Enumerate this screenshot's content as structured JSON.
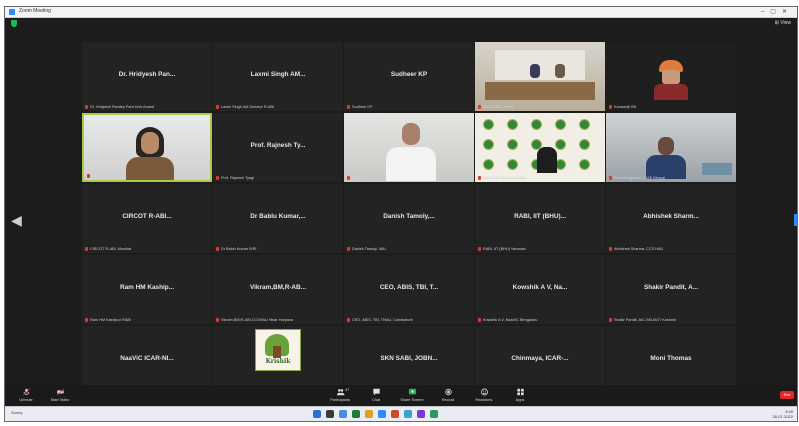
{
  "window": {
    "title": "Zoom Meeting"
  },
  "view_label": "View",
  "tiles": [
    {
      "name": "Dr. Hridyesh Pan...",
      "label": "Dr. Hridyesh Pandey Pant Univ Anand",
      "video": false
    },
    {
      "name": "Laxmi Singh AM...",
      "label": "Laxmi Singh AM Director R-ABI",
      "video": false
    },
    {
      "name": "Sudheer KP",
      "label": "Sudheer KP",
      "video": false
    },
    {
      "name": "",
      "label": "AAU RABI, Jorhat",
      "video": "room"
    },
    {
      "name": "",
      "label": "Kanwarjit Gill",
      "video": "turban"
    },
    {
      "name": "",
      "label": "Dr. Rajeswari Nayak",
      "video": "woman"
    },
    {
      "name": "Prof. Rajnesh Ty...",
      "label": "Prof. Rajnesh Tyagi",
      "video": false
    },
    {
      "name": "",
      "label": "Dinesh",
      "video": "man-white"
    },
    {
      "name": "",
      "label": "SAU RABI Rajendranagar",
      "video": "logo-wall"
    },
    {
      "name": "",
      "label": "Rakshit Agarwal, CIAE Bhopal",
      "video": "man-dark"
    },
    {
      "name": "CIRCOT R-ABI...",
      "label": "CIRCOT R-ABI, Mumbai",
      "video": false
    },
    {
      "name": "Dr Bablu Kumar,...",
      "label": "Dr Bablu Kumar IVRI",
      "video": false
    },
    {
      "name": "Danish Tamoly,...",
      "label": "Danish Tamoly, IIAU",
      "video": false
    },
    {
      "name": "RABI, IIT (BHU)...",
      "label": "RABI, IIT (BHU) Varanasi",
      "video": false
    },
    {
      "name": "Abhishek Sharm...",
      "label": "Abhishek Sharma, CCS HAU",
      "video": false
    },
    {
      "name": "Ram HM Kaship...",
      "label": "Ram HM Kashipur RABI",
      "video": false
    },
    {
      "name": "Vikram,BM,R-AB...",
      "label": "Vikram,BM,R-ABI,CCSHAU Hisar Haryana",
      "video": false
    },
    {
      "name": "CEO, ABIS, TBI, T...",
      "label": "CEO, ABIS, TBI, TNAU, Coimbatore",
      "video": false
    },
    {
      "name": "Kowshik A V, Na...",
      "label": "Kowshik A V, NaaVIC Bengaluru",
      "video": false
    },
    {
      "name": "Shakir Pandit, A...",
      "label": "Shakir Pandit, AIC-SKUAST Kashmir",
      "video": false
    },
    {
      "name": "NaaViC ICAR-NI...",
      "label": "NaaViC ICAR-NIANP",
      "video": false
    },
    {
      "name": "",
      "label": "KRISHIK Agribusiness Incubation, UAHS",
      "video": "krishik"
    },
    {
      "name": "SKN SABI, JOBN...",
      "label": "SKN SABI, JOBNER RKVY-RAFTAAR",
      "video": false
    },
    {
      "name": "Chinmaya, ICAR-...",
      "label": "Chinmaya, ICAR-CIFT",
      "video": false
    },
    {
      "name": "Moni Thomas",
      "label": "Moni Thomas",
      "video": false
    }
  ],
  "krishik_logo_text": "Krishik",
  "toolbar": {
    "left": [
      {
        "label": "Unmute",
        "icon": "microphone-muted-icon"
      },
      {
        "label": "Start Video",
        "icon": "video-camera-off-icon"
      }
    ],
    "center": [
      {
        "label": "Participants",
        "icon": "participants-icon",
        "count": "47"
      },
      {
        "label": "Chat",
        "icon": "chat-icon"
      },
      {
        "label": "Share Screen",
        "icon": "share-screen-icon"
      },
      {
        "label": "Record",
        "icon": "record-icon"
      },
      {
        "label": "Reactions",
        "icon": "reactions-icon"
      },
      {
        "label": "Apps",
        "icon": "apps-icon"
      }
    ],
    "end_label": "End"
  },
  "taskbar": {
    "weather": "Sunny",
    "time": "3:45",
    "date": "26-07-2022"
  },
  "colors": {
    "active_border": "#a9c94a",
    "end": "#e02828",
    "share": "#1db954",
    "zoom_blue": "#2d8cff"
  }
}
